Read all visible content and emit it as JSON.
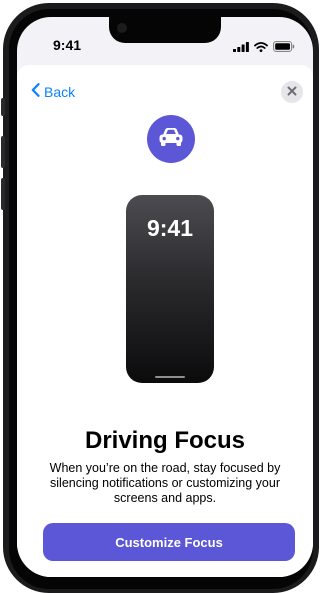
{
  "status_bar": {
    "time": "9:41"
  },
  "nav": {
    "back_label": "Back"
  },
  "preview": {
    "time": "9:41"
  },
  "content": {
    "title": "Driving Focus",
    "description": "When you’re on the road, stay focused by silencing notifications or customizing your screens and apps."
  },
  "actions": {
    "customize_label": "Customize Focus"
  },
  "colors": {
    "accent": "#5b57d6",
    "link": "#0a84ff"
  },
  "icons": {
    "focus": "car-icon",
    "back": "chevron-left-icon",
    "close": "close-icon",
    "status": [
      "cellular-signal-icon",
      "wifi-icon",
      "battery-icon"
    ]
  }
}
